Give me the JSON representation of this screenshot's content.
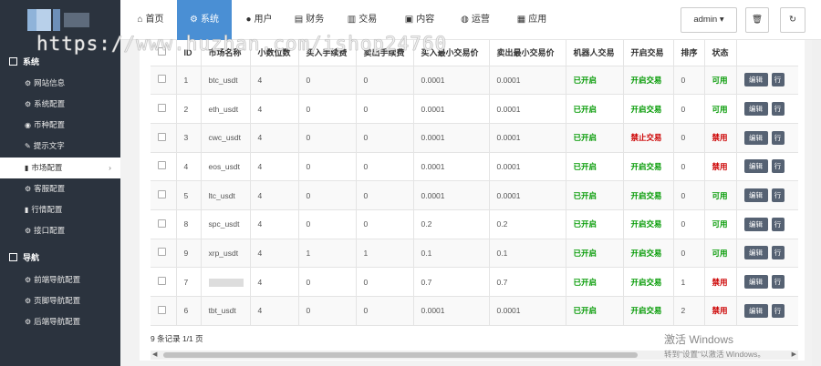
{
  "topnav": {
    "tabs": [
      {
        "label": "首页",
        "icon": "home-icon"
      },
      {
        "label": "系统",
        "icon": "gear-icon"
      },
      {
        "label": "用户",
        "icon": "user-icon"
      },
      {
        "label": "财务",
        "icon": "finance-icon"
      },
      {
        "label": "交易",
        "icon": "bar-chart-icon"
      },
      {
        "label": "内容",
        "icon": "document-icon"
      },
      {
        "label": "运营",
        "icon": "globe-icon"
      },
      {
        "label": "应用",
        "icon": "grid-icon"
      }
    ],
    "active_tab": "系统",
    "admin_label": "admin",
    "accent_color": "#4a8fd4"
  },
  "watermark": "https://www.huzhan.com/ishop24760",
  "sidebar": {
    "sections": [
      {
        "title": "系统",
        "items": [
          "网站信息",
          "系统配置",
          "币种配置",
          "提示文字",
          "市场配置",
          "客服配置",
          "行情配置",
          "接口配置"
        ]
      },
      {
        "title": "导航",
        "items": [
          "前端导航配置",
          "页脚导航配置",
          "后端导航配置"
        ]
      }
    ],
    "active_item": "市场配置",
    "bg_color": "#2b333e"
  },
  "table": {
    "headers": [
      "",
      "ID",
      "市场名称",
      "小数位数",
      "买入手续费",
      "卖出手续费",
      "买入最小交易价",
      "卖出最小交易价",
      "机器人交易",
      "开启交易",
      "排序",
      "状态",
      ""
    ],
    "rows": [
      {
        "id": "1",
        "name": "btc_usdt",
        "decimals": "4",
        "buy_fee": "0",
        "sell_fee": "0",
        "buy_min": "0.0001",
        "sell_min": "0.0001",
        "robot": "已开启",
        "trade": "开启交易",
        "sort": "0",
        "status": "可用"
      },
      {
        "id": "2",
        "name": "eth_usdt",
        "decimals": "4",
        "buy_fee": "0",
        "sell_fee": "0",
        "buy_min": "0.0001",
        "sell_min": "0.0001",
        "robot": "已开启",
        "trade": "开启交易",
        "sort": "0",
        "status": "可用"
      },
      {
        "id": "3",
        "name": "cwc_usdt",
        "decimals": "4",
        "buy_fee": "0",
        "sell_fee": "0",
        "buy_min": "0.0001",
        "sell_min": "0.0001",
        "robot": "已开启",
        "trade": "禁止交易",
        "sort": "0",
        "status": "禁用"
      },
      {
        "id": "4",
        "name": "eos_usdt",
        "decimals": "4",
        "buy_fee": "0",
        "sell_fee": "0",
        "buy_min": "0.0001",
        "sell_min": "0.0001",
        "robot": "已开启",
        "trade": "开启交易",
        "sort": "0",
        "status": "禁用"
      },
      {
        "id": "5",
        "name": "ltc_usdt",
        "decimals": "4",
        "buy_fee": "0",
        "sell_fee": "0",
        "buy_min": "0.0001",
        "sell_min": "0.0001",
        "robot": "已开启",
        "trade": "开启交易",
        "sort": "0",
        "status": "可用"
      },
      {
        "id": "8",
        "name": "spc_usdt",
        "decimals": "4",
        "buy_fee": "0",
        "sell_fee": "0",
        "buy_min": "0.2",
        "sell_min": "0.2",
        "robot": "已开启",
        "trade": "开启交易",
        "sort": "0",
        "status": "可用"
      },
      {
        "id": "9",
        "name": "xrp_usdt",
        "decimals": "4",
        "buy_fee": "1",
        "sell_fee": "1",
        "buy_min": "0.1",
        "sell_min": "0.1",
        "robot": "已开启",
        "trade": "开启交易",
        "sort": "0",
        "status": "可用"
      },
      {
        "id": "7",
        "name": "",
        "decimals": "4",
        "buy_fee": "0",
        "sell_fee": "0",
        "buy_min": "0.7",
        "sell_min": "0.7",
        "robot": "已开启",
        "trade": "开启交易",
        "sort": "1",
        "status": "禁用"
      },
      {
        "id": "6",
        "name": "tbt_usdt",
        "decimals": "4",
        "buy_fee": "0",
        "sell_fee": "0",
        "buy_min": "0.0001",
        "sell_min": "0.0001",
        "robot": "已开启",
        "trade": "开启交易",
        "sort": "2",
        "status": "禁用"
      }
    ],
    "edit_label": "编辑",
    "more_label": "行"
  },
  "pagination": "9 条记录 1/1 页",
  "windows_activation": {
    "line1": "激活 Windows",
    "line2": "转到\"设置\"以激活 Windows。"
  }
}
